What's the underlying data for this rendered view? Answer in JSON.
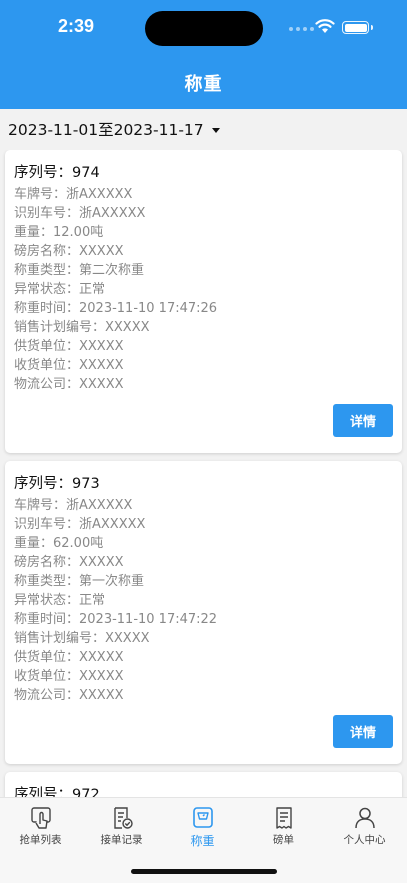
{
  "status_bar": {
    "time": "2:39"
  },
  "header": {
    "title": "称重"
  },
  "filter": {
    "date_range": "2023-11-01至2023-11-17"
  },
  "records": [
    {
      "title": "序列号：974",
      "fields": [
        "车牌号：浙AXXXXX",
        "识别车号：浙AXXXXX",
        "重量：12.00吨",
        "磅房名称：XXXXX",
        "称重类型：第二次称重",
        "异常状态：正常",
        "称重时间：2023-11-10 17:47:26",
        "销售计划编号：XXXXX",
        "供货单位：XXXXX",
        "收货单位：XXXXX",
        "物流公司：XXXXX"
      ],
      "button": "详情"
    },
    {
      "title": "序列号：973",
      "fields": [
        "车牌号：浙AXXXXX",
        "识别车号：浙AXXXXX",
        "重量：62.00吨",
        "磅房名称：XXXXX",
        "称重类型：第一次称重",
        "异常状态：正常",
        "称重时间：2023-11-10 17:47:22",
        "销售计划编号：XXXXX",
        "供货单位：XXXXX",
        "收货单位：XXXXX",
        "物流公司：XXXXX"
      ],
      "button": "详情"
    },
    {
      "title": "序列号：972"
    }
  ],
  "tabbar": {
    "items": [
      {
        "label": "抢单列表",
        "icon": "hand-pointer-icon"
      },
      {
        "label": "接单记录",
        "icon": "document-check-icon"
      },
      {
        "label": "称重",
        "icon": "scale-icon",
        "active": true
      },
      {
        "label": "磅单",
        "icon": "receipt-icon"
      },
      {
        "label": "个人中心",
        "icon": "person-icon"
      }
    ],
    "active_color": "#2d97ef"
  },
  "colors": {
    "primary": "#2d97ef",
    "muted_text": "#888888"
  }
}
